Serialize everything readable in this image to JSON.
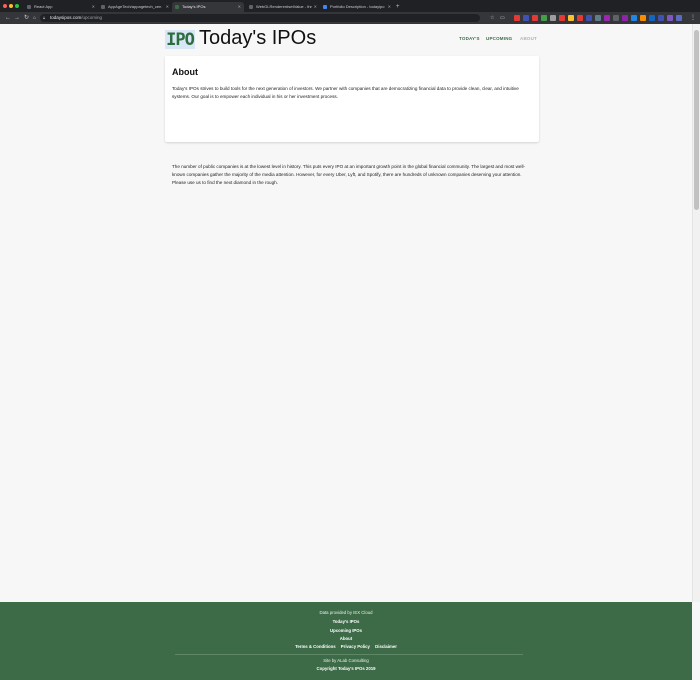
{
  "browser": {
    "tabs": [
      {
        "title": "React App",
        "favicon_color": "#5f6368"
      },
      {
        "title": "AppAgeTech/appagetech_cen",
        "favicon_color": "#5f6368"
      },
      {
        "title": "Today's IPOs",
        "favicon_color": "#3d6b47"
      },
      {
        "title": "WebGLRenderer#setValue - thr",
        "favicon_color": "#5f6368"
      },
      {
        "title": "Portfolio Description - todayipo",
        "favicon_color": "#4285f4"
      }
    ],
    "new_tab": "+",
    "url_domain": "todaysipos.com",
    "url_path": "/upcoming",
    "extension_colors": [
      "#e53935",
      "#3f51b5",
      "#e53935",
      "#43a047",
      "#9e9e9e",
      "#e53935",
      "#fbc02d",
      "#e53935",
      "#3f51b5",
      "#607d8b",
      "#9c27b0",
      "#5f6368",
      "#8e24aa",
      "#1e88e5",
      "#fb8c00",
      "#1565c0",
      "#3f51b5",
      "#7e57c2",
      "#5c6bc0"
    ]
  },
  "header": {
    "logo_text": "IPO",
    "title": "Today's IPOs",
    "nav": [
      {
        "label": "TODAY'S",
        "active": true
      },
      {
        "label": "UPCOMING",
        "active": true
      },
      {
        "label": "ABOUT",
        "active": false
      }
    ]
  },
  "about": {
    "heading": "About",
    "paragraph1": "Today's IPOs strives to build tools for the next generation of investors. We partner with companies that are democratizing financial data to provide clean, clear, and intuitive systems. Our goal is to empower each individual in his or her investment process.",
    "paragraph2": "The number of public companies is at the lowest level in history. This puts every IPO at an important growth point in the global financial community. The largest and most well-known companies gather the majority of the media attention. However, for every Uber, Lyft, and Spotify, there are hundreds of unknown companies deserving your attention. Please use us to find the next diamond in the rough."
  },
  "footer": {
    "data_credit": "Data provided by IEX Cloud",
    "link1": "Today's IPOs",
    "link2": "Upcoming IPOs",
    "link3": "About",
    "legal": [
      "Terms & Conditions",
      "Privacy Policy",
      "Disclaimer"
    ],
    "site_by": "Site by ALab Consulting",
    "copyright": "Copyright Today's IPOs 2019"
  }
}
